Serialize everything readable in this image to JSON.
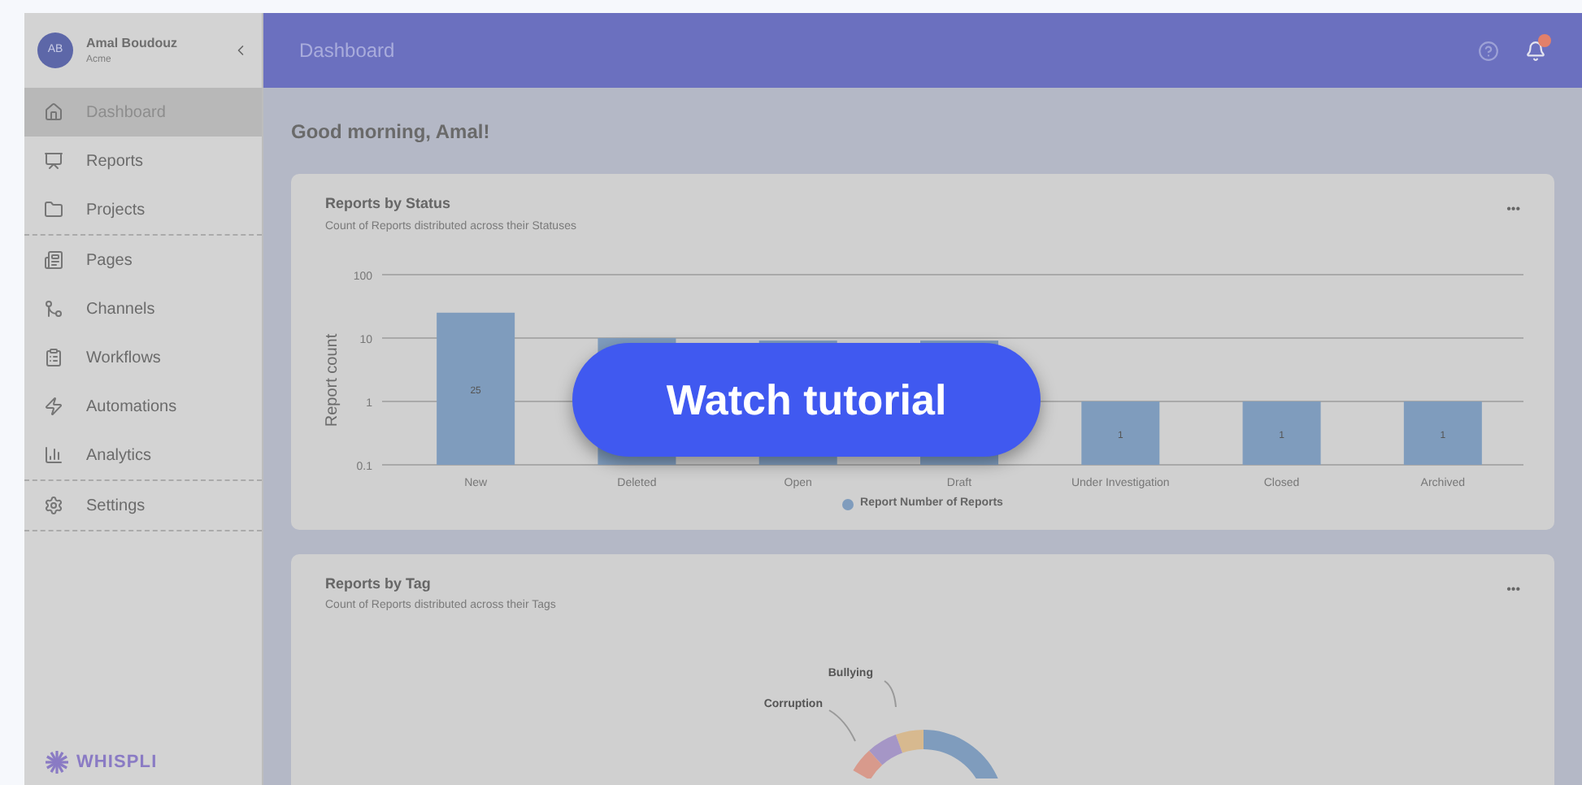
{
  "user": {
    "initials": "AB",
    "name": "Amal Boudouz",
    "org": "Acme"
  },
  "sidebar": {
    "items": [
      {
        "label": "Dashboard",
        "selected": true,
        "divider_after": false
      },
      {
        "label": "Reports",
        "selected": false,
        "divider_after": false
      },
      {
        "label": "Projects",
        "selected": false,
        "divider_after": true
      },
      {
        "label": "Pages",
        "selected": false,
        "divider_after": false
      },
      {
        "label": "Channels",
        "selected": false,
        "divider_after": false
      },
      {
        "label": "Workflows",
        "selected": false,
        "divider_after": false
      },
      {
        "label": "Automations",
        "selected": false,
        "divider_after": false
      },
      {
        "label": "Analytics",
        "selected": false,
        "divider_after": true
      },
      {
        "label": "Settings",
        "selected": false,
        "divider_after": true
      }
    ],
    "logo": "WHISPLI"
  },
  "header": {
    "title": "Dashboard",
    "notification_badge": true
  },
  "greeting": "Good morning, Amal!",
  "cards": [
    {
      "title": "Reports by Status",
      "subtitle": "Count of Reports distributed across their Statuses",
      "menu": "•••",
      "log_bar_chart": {
        "ylabel": "Report count",
        "y_axis_labels": [
          "100",
          "10",
          "1",
          "0.1"
        ],
        "bars": [
          {
            "label": "New",
            "value_label": "25"
          },
          {
            "label": "Deleted"
          },
          {
            "label": "Open"
          },
          {
            "label": "Draft"
          },
          {
            "label": "Under Investigation",
            "value_label": "1"
          },
          {
            "label": "Closed",
            "value_label": "1"
          },
          {
            "label": "Archived",
            "value_label": "1"
          }
        ],
        "legend": {
          "name": "Report Number of Reports",
          "color": "#7f9cbd"
        }
      }
    },
    {
      "title": "Reports by Tag",
      "subtitle": "Count of Reports distributed across their Tags",
      "menu": "•••",
      "donut_labels": [
        "Bullying",
        "Corruption"
      ]
    }
  ],
  "tutorial_button": "Watch tutorial"
}
